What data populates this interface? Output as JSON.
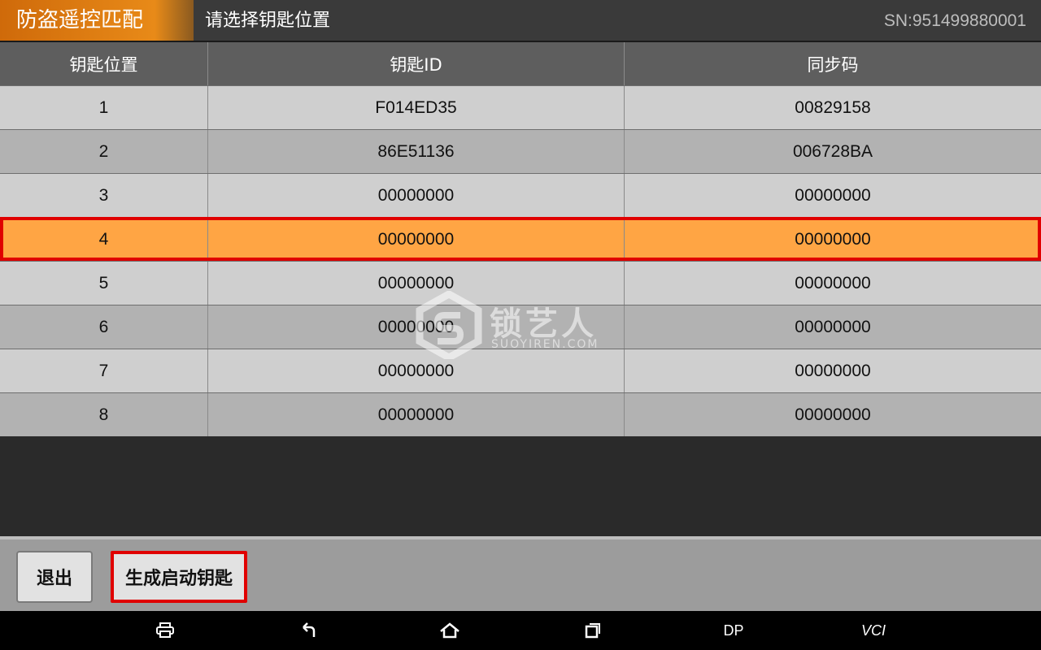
{
  "header": {
    "app_title": "防盗遥控匹配",
    "subtitle": "请选择钥匙位置",
    "serial": "SN:951499880001"
  },
  "table": {
    "columns": [
      "钥匙位置",
      "钥匙ID",
      "同步码"
    ],
    "rows": [
      {
        "position": "1",
        "key_id": "F014ED35",
        "sync_code": "00829158"
      },
      {
        "position": "2",
        "key_id": "86E51136",
        "sync_code": "006728BA"
      },
      {
        "position": "3",
        "key_id": "00000000",
        "sync_code": "00000000"
      },
      {
        "position": "4",
        "key_id": "00000000",
        "sync_code": "00000000"
      },
      {
        "position": "5",
        "key_id": "00000000",
        "sync_code": "00000000"
      },
      {
        "position": "6",
        "key_id": "00000000",
        "sync_code": "00000000"
      },
      {
        "position": "7",
        "key_id": "00000000",
        "sync_code": "00000000"
      },
      {
        "position": "8",
        "key_id": "00000000",
        "sync_code": "00000000"
      }
    ],
    "selected_row": "4"
  },
  "watermark": {
    "text": "锁艺人",
    "sub": "SUOYIREN.COM"
  },
  "footer": {
    "exit_label": "退出",
    "generate_label": "生成启动钥匙"
  },
  "navbar": {
    "dp_label": "DP",
    "vci_label": "VCI",
    "icons": [
      "print-icon",
      "back-icon",
      "home-icon",
      "recents-icon"
    ]
  },
  "colors": {
    "accent": "#e88a18",
    "selected_row": "#ffa544",
    "highlight_border": "#e00000"
  }
}
